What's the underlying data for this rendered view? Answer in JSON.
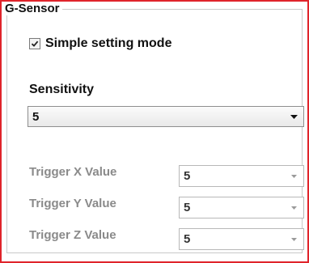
{
  "group": {
    "title": "G-Sensor"
  },
  "simple_mode": {
    "label": "Simple setting mode",
    "checked": true
  },
  "sensitivity": {
    "label": "Sensitivity",
    "value": "5"
  },
  "triggers": [
    {
      "label": "Trigger X Value",
      "value": "5"
    },
    {
      "label": "Trigger Y Value",
      "value": "5"
    },
    {
      "label": "Trigger Z Value",
      "value": "5"
    }
  ],
  "colors": {
    "frame_border": "#e0242b",
    "disabled_text": "#8a8a8a"
  },
  "icons": {
    "dropdown": "chevron-down-icon",
    "check": "checkmark-icon"
  }
}
